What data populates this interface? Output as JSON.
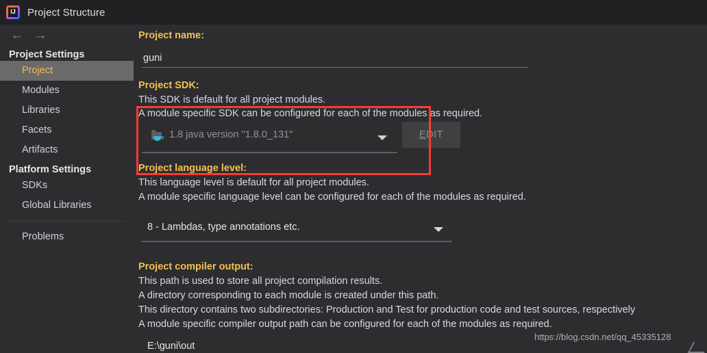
{
  "window": {
    "title": "Project Structure",
    "icon": "intellij-idea-logo"
  },
  "nav": {
    "back_icon": "arrow-left-icon",
    "forward_icon": "arrow-right-icon"
  },
  "sidebar": {
    "groups": [
      {
        "title": "Project Settings",
        "items": [
          {
            "label": "Project",
            "selected": true
          },
          {
            "label": "Modules",
            "selected": false
          },
          {
            "label": "Libraries",
            "selected": false
          },
          {
            "label": "Facets",
            "selected": false
          },
          {
            "label": "Artifacts",
            "selected": false
          }
        ]
      },
      {
        "title": "Platform Settings",
        "items": [
          {
            "label": "SDKs",
            "selected": false
          },
          {
            "label": "Global Libraries",
            "selected": false
          }
        ]
      }
    ],
    "extra": {
      "label": "Problems"
    }
  },
  "main": {
    "project_name": {
      "label": "Project name:",
      "value": "guni"
    },
    "project_sdk": {
      "label": "Project SDK:",
      "desc_line1": "This SDK is default for all project modules.",
      "desc_line2": "A module specific SDK can be configured for each of the modules as required.",
      "selected": "1.8 java version \"1.8.0_131\"",
      "icon": "jdk-folder-coffee-icon",
      "dropdown_icon": "chevron-down-icon",
      "edit_button": "EDIT",
      "edit_mnemonic": "E"
    },
    "language_level": {
      "label": "Project language level:",
      "desc_line1": "This language level is default for all project modules.",
      "desc_line2": "A module specific language level can be configured for each of the modules as required.",
      "selected": "8 - Lambdas, type annotations etc.",
      "dropdown_icon": "chevron-down-icon"
    },
    "compiler_output": {
      "label": "Project compiler output:",
      "desc_line1": "This path is used to store all project compilation results.",
      "desc_line2": "A directory corresponding to each module is created under this path.",
      "desc_line3": "This directory contains two subdirectories: Production and Test for production code and test sources, respectively",
      "desc_line4": "A module specific compiler output path can be configured for each of the modules as required.",
      "value": "E:\\guni\\out"
    }
  },
  "annotation": {
    "highlight_color": "#fc3a36"
  },
  "watermark": {
    "text": "https://blog.csdn.net/qq_45335128"
  }
}
